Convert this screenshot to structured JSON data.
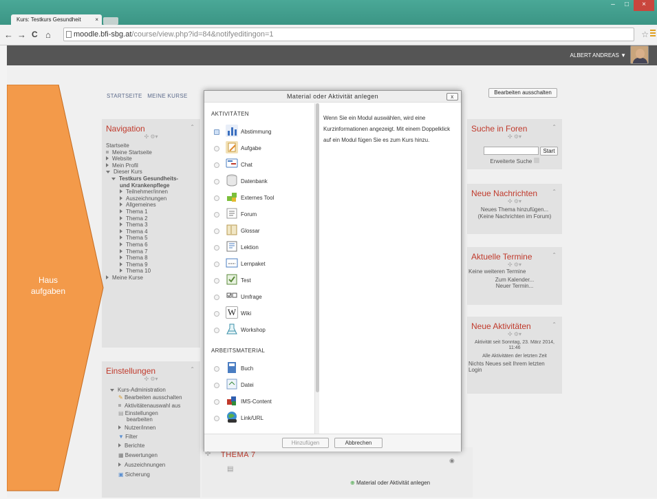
{
  "browser": {
    "tab_title": "Kurs: Testkurs Gesundheit",
    "tab_close": "×",
    "url_host": "moodle.bfi-sbg.at",
    "url_path": "/course/view.php?id=84&notifyeditingon=1",
    "back": "←",
    "forward": "→",
    "reload": "C",
    "home": "⌂",
    "star": "☆",
    "minimize": "–",
    "maximize": "□",
    "close": "×"
  },
  "header": {
    "user_name": "ALBERT ANDREAS",
    "user_caret": "▼"
  },
  "breadcrumb": {
    "home": "STARTSEITE",
    "my_courses": "MEINE KURSE"
  },
  "edit_off_button": "Bearbeiten ausschalten",
  "annotation": {
    "label_line1": "Haus",
    "label_line2": "aufgaben",
    "color": "#f39a4a"
  },
  "navigation": {
    "title": "Navigation",
    "items": [
      "Startseite",
      "Meine Startseite",
      "Website",
      "Mein Profil",
      "Dieser Kurs",
      "Testkurs Gesundheits-",
      "und Krankenpflege",
      "Teilnehmer/innen",
      "Auszeichnungen",
      "Allgemeines",
      "Thema 1",
      "Thema 2",
      "Thema 3",
      "Thema 4",
      "Thema 5",
      "Thema 6",
      "Thema 7",
      "Thema 8",
      "Thema 9",
      "Thema 10",
      "Meine Kurse"
    ]
  },
  "settings": {
    "title": "Einstellungen",
    "items": [
      "Kurs-Administration",
      "Bearbeiten ausschalten",
      "Aktivitätenauswahl aus",
      "Einstellungen",
      "bearbeiten",
      "Nutzer/innen",
      "Filter",
      "Berichte",
      "Bewertungen",
      "Auszeichnungen",
      "Sicherung"
    ]
  },
  "modal": {
    "title": "Material oder Aktivität anlegen",
    "close": "x",
    "section_activities": "AKTIVITÄTEN",
    "activities": [
      "Abstimmung",
      "Aufgabe",
      "Chat",
      "Datenbank",
      "Externes Tool",
      "Forum",
      "Glossar",
      "Lektion",
      "Lernpaket",
      "Test",
      "Umfrage",
      "Wiki",
      "Workshop"
    ],
    "section_resources": "ARBEITSMATERIAL",
    "resources": [
      "Buch",
      "Datei",
      "IMS-Content",
      "Link/URL"
    ],
    "description": "Wenn Sie ein Modul auswählen, wird eine Kurzinformationen angezeigt. Mit einem Doppelklick auf ein Modul fügen Sie es zum Kurs hinzu.",
    "add_button": "Hinzufügen",
    "cancel_button": "Abbrechen"
  },
  "course": {
    "section_title": "THEMA 7",
    "add_activity": "Material oder Aktivität anlegen"
  },
  "search_forums": {
    "title": "Suche in Foren",
    "button": "Start",
    "advanced": "Erweiterte Suche"
  },
  "news": {
    "title": "Neue Nachrichten",
    "add": "Neues Thema hinzufügen...",
    "none": "(Keine Nachrichten im Forum)"
  },
  "events": {
    "title": "Aktuelle Termine",
    "none": "Keine weiteren Termine",
    "calendar": "Zum Kalender...",
    "new": "Neuer Termin..."
  },
  "recent": {
    "title": "Neue Aktivitäten",
    "since_line1": "Aktivität seit Sonntag, 23. März 2014,",
    "since_line2": "11:46",
    "all": "Alle Aktivitäten der letzten Zeit",
    "none_line1": "Nichts Neues seit Ihrem letzten",
    "none_line2": "Login"
  },
  "block_controls": "✣ ⚙▾"
}
